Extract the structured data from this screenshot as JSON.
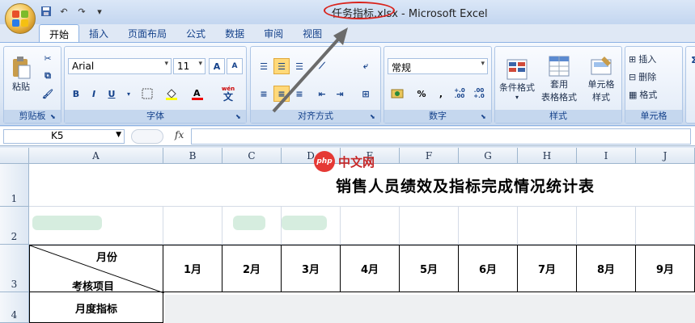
{
  "window": {
    "title_filename": "任务指标.xlsx",
    "title_app": " - Microsoft Excel"
  },
  "tabs": [
    "开始",
    "插入",
    "页面布局",
    "公式",
    "数据",
    "审阅",
    "视图"
  ],
  "ribbon": {
    "clipboard": {
      "label": "剪贴板",
      "paste": "粘贴"
    },
    "font": {
      "label": "字体",
      "font_name": "Arial",
      "font_size": "11",
      "bold": "B",
      "italic": "I",
      "underline": "U",
      "grow": "A",
      "shrink": "A",
      "wen": "wén",
      "wen_char": "文"
    },
    "alignment": {
      "label": "对齐方式"
    },
    "number": {
      "label": "数字",
      "format": "常规",
      "percent": "%",
      "comma": ",",
      "inc_dec": "+.0 .00",
      "dec_dec": ".00 +.0"
    },
    "styles": {
      "label": "样式",
      "cond_format": "条件格式",
      "table_format_1": "套用",
      "table_format_2": "表格格式",
      "cell_style_1": "单元格",
      "cell_style_2": "样式"
    },
    "cells": {
      "label": "单元格",
      "insert": "插入",
      "delete": "删除",
      "format": "格式"
    }
  },
  "formula_bar": {
    "name_box": "K5",
    "fx": "fx",
    "value": ""
  },
  "grid": {
    "columns": [
      "A",
      "B",
      "C",
      "D",
      "E",
      "F",
      "G",
      "H",
      "I",
      "J"
    ],
    "rows": [
      "1",
      "2",
      "3",
      "4"
    ],
    "sheet_title": "销售人员绩效及指标完成情况统计表",
    "header_month": "月份",
    "header_item": "考核项目",
    "months": [
      "1月",
      "2月",
      "3月",
      "4月",
      "5月",
      "6月",
      "7月",
      "8月",
      "9月"
    ],
    "row4_label": "月度指标"
  },
  "watermark": {
    "logo": "php",
    "text": "中文网"
  },
  "colors": {
    "annotation_red": "#d9211a",
    "ribbon_blue": "#15428b",
    "watermark_red": "#c62828"
  }
}
